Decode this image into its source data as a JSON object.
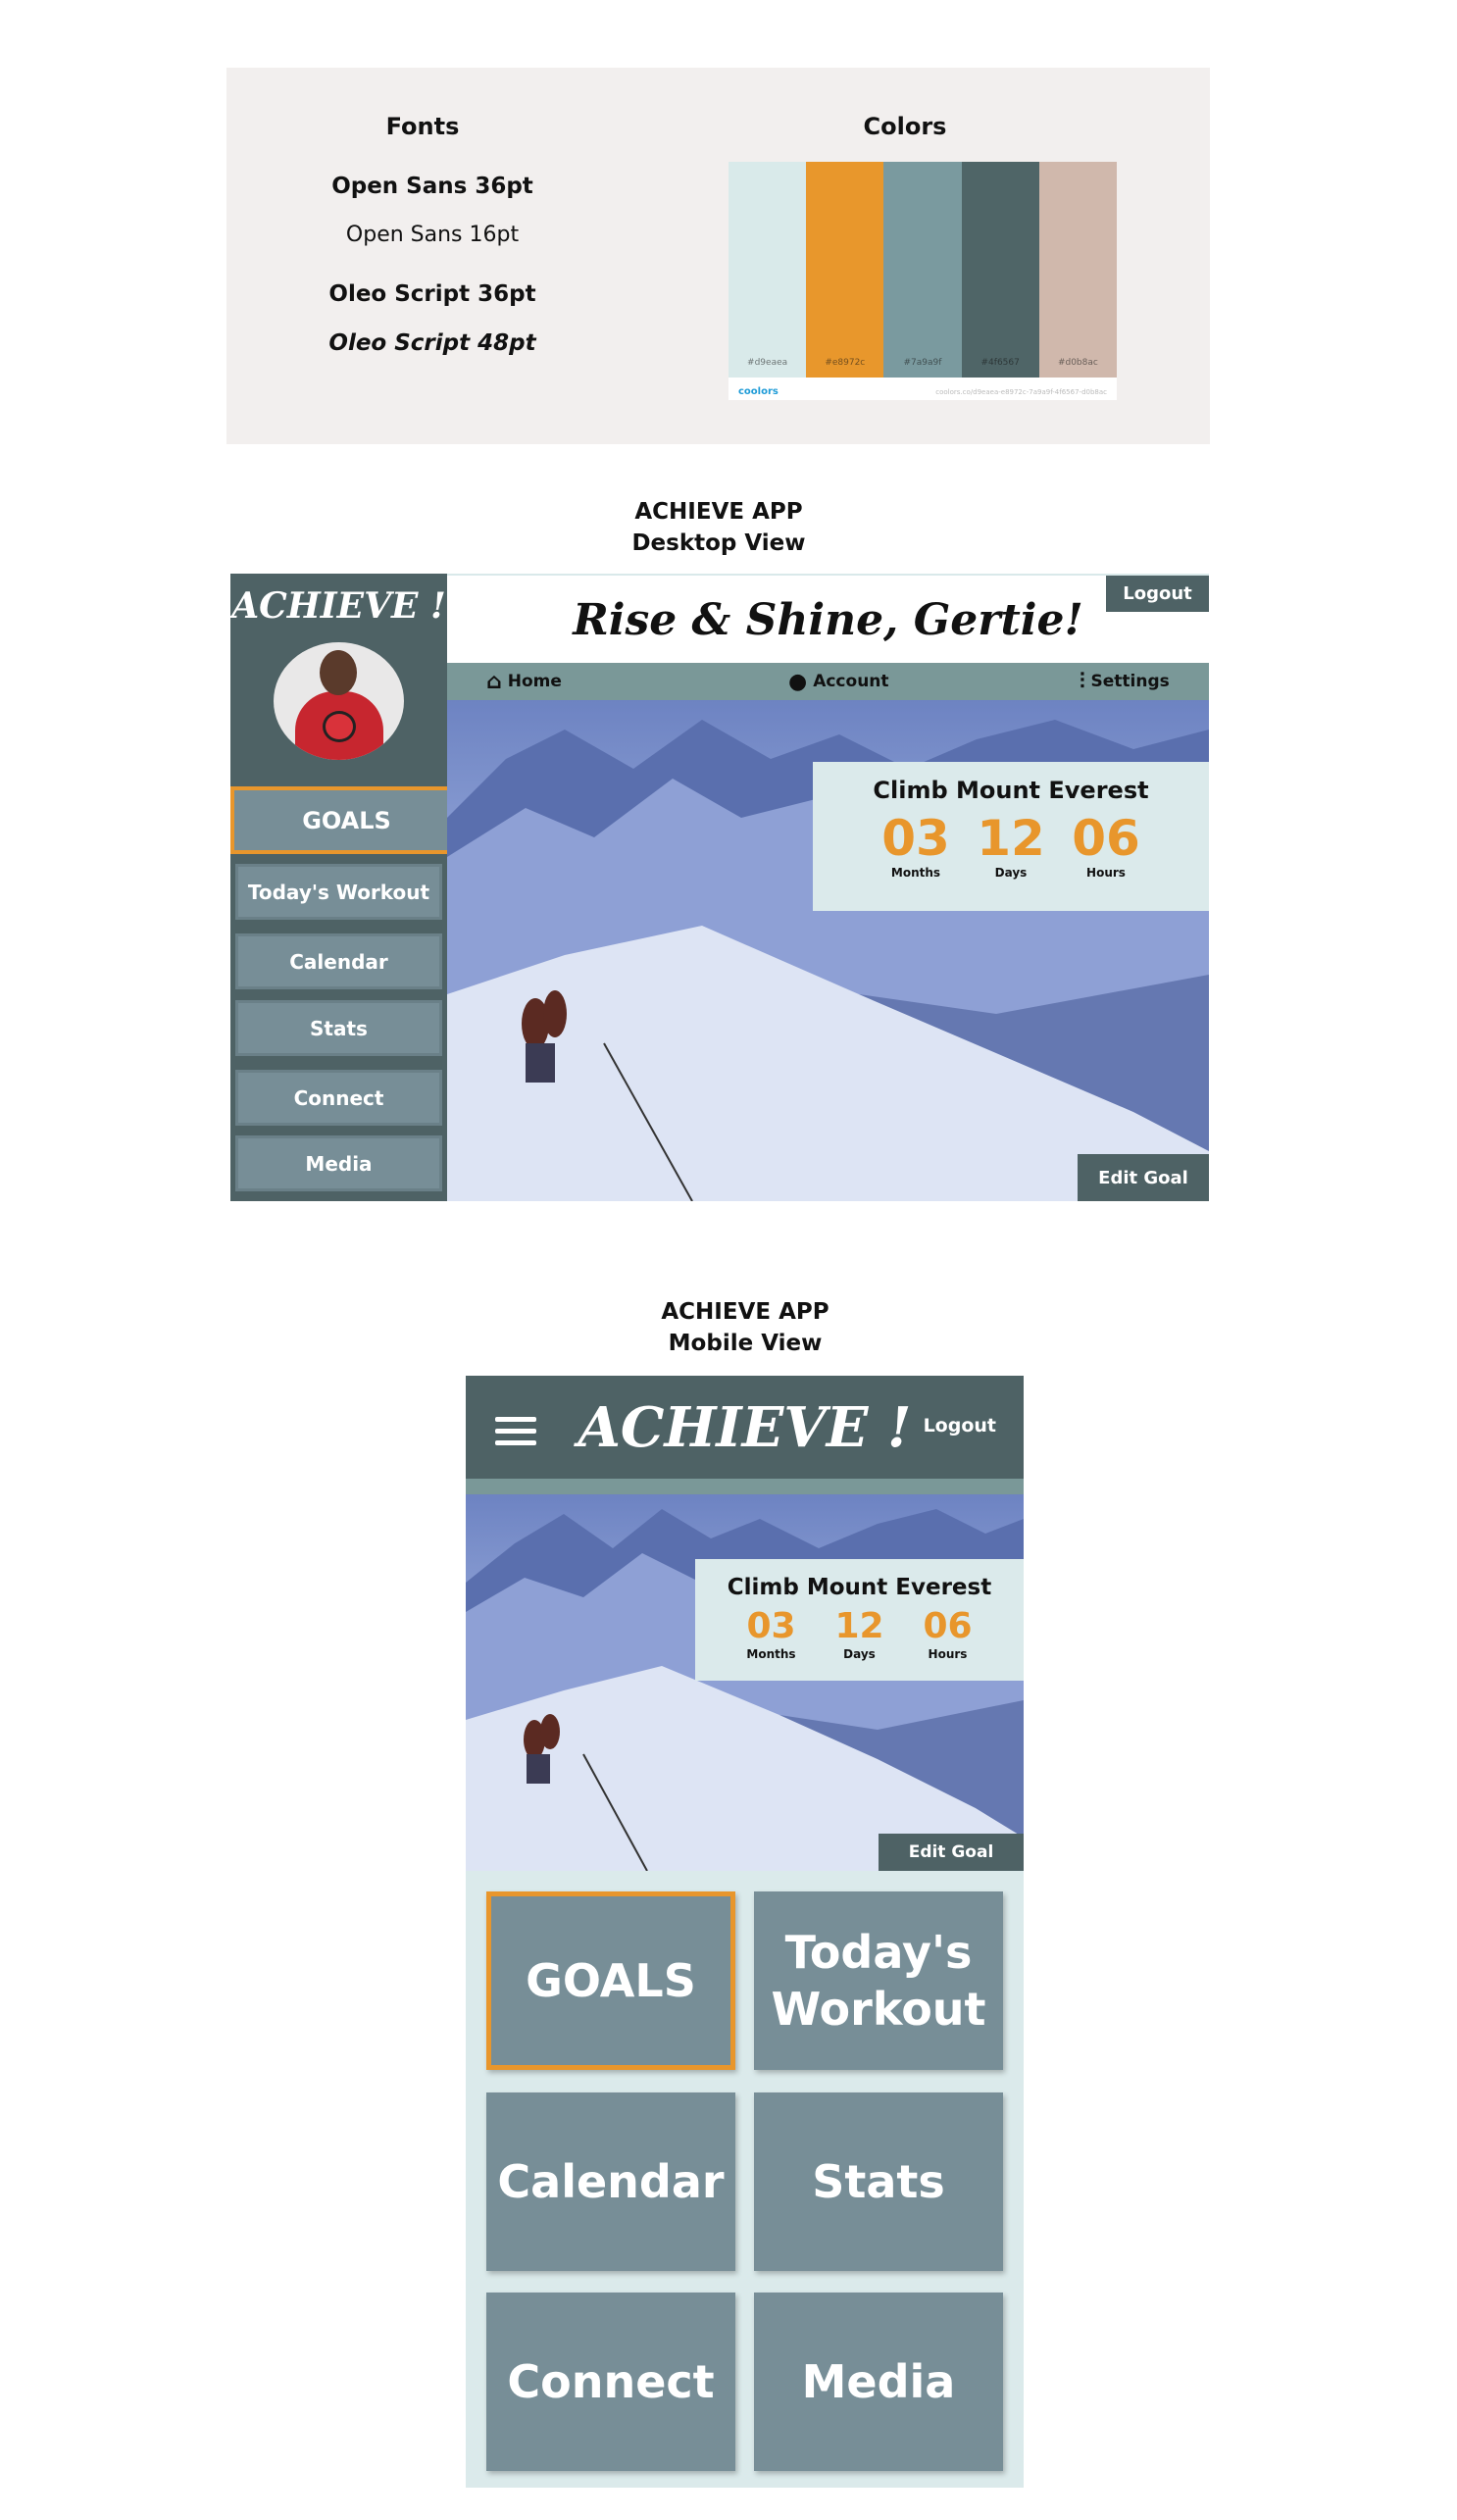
{
  "style_guide": {
    "fonts_title": "Fonts",
    "colors_title": "Colors",
    "font_samples": [
      "Open Sans 36pt",
      "Open Sans 16pt",
      "Oleo Script 36pt",
      "Oleo Script 48pt"
    ],
    "palette": [
      {
        "hex": "#d9eaea",
        "label": "#d9eaea"
      },
      {
        "hex": "#e8972c",
        "label": "#e8972c"
      },
      {
        "hex": "#7a9a9f",
        "label": "#7a9a9f"
      },
      {
        "hex": "#4f6567",
        "label": "#4f6567"
      },
      {
        "hex": "#d0b8ac",
        "label": "#d0b8ac"
      }
    ],
    "palette_brand": "coolors",
    "palette_url": "coolors.co/d9eaea-e8972c-7a9a9f-4f6567-d0b8ac"
  },
  "desktop": {
    "caption_line1": "ACHIEVE APP",
    "caption_line2": "Desktop View",
    "logo": "ACHIEVE !",
    "greeting": "Rise & Shine, Gertie!",
    "logout": "Logout",
    "nav": [
      {
        "label": "Home",
        "icon": "home-icon"
      },
      {
        "label": "Account",
        "icon": "user-icon"
      },
      {
        "label": "Settings",
        "icon": "sliders-icon"
      }
    ],
    "sidebar": [
      "GOALS",
      "Today's Workout",
      "Calendar",
      "Stats",
      "Connect",
      "Media"
    ],
    "goal": {
      "title": "Climb Mount Everest",
      "months": "03",
      "months_label": "Months",
      "days": "12",
      "days_label": "Days",
      "hours": "06",
      "hours_label": "Hours"
    },
    "edit_goal": "Edit Goal"
  },
  "mobile": {
    "caption_line1": "ACHIEVE APP",
    "caption_line2": "Mobile View",
    "logo": "ACHIEVE !",
    "logout": "Logout",
    "goal": {
      "title": "Climb Mount Everest",
      "months": "03",
      "months_label": "Months",
      "days": "12",
      "days_label": "Days",
      "hours": "06",
      "hours_label": "Hours"
    },
    "edit_goal": "Edit Goal",
    "tiles": [
      "GOALS",
      "Today's Workout",
      "Calendar",
      "Stats",
      "Connect",
      "Media"
    ]
  },
  "colors": {
    "accent": "#e8962c",
    "dark": "#4e6265",
    "mid": "#7a9898",
    "light": "#dbeaeb",
    "tile": "#778e97"
  }
}
